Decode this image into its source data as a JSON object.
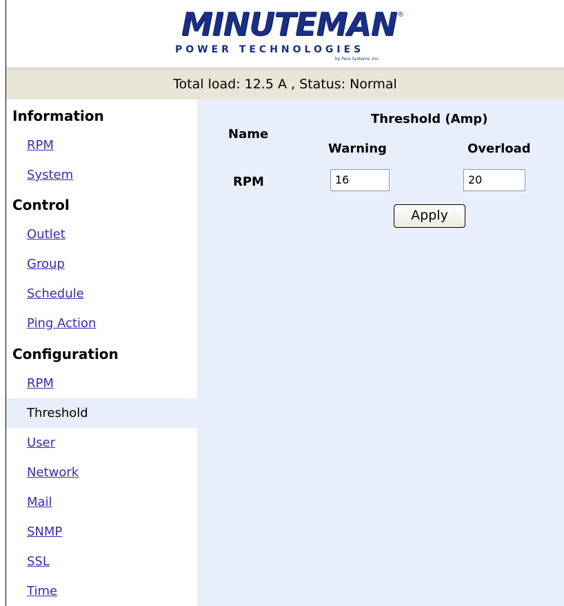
{
  "brand": {
    "logo_text": "MINUTEMAN",
    "subtitle": "POWER TECHNOLOGIES",
    "tagline": "by Para Systems, Inc.",
    "registered_mark": "®",
    "color": "#1a2e86"
  },
  "status_bar": {
    "text": "Total load: 12.5 A , Status: Normal"
  },
  "sidebar": {
    "sections": [
      {
        "title": "Information",
        "items": [
          "RPM",
          "System"
        ]
      },
      {
        "title": "Control",
        "items": [
          "Outlet",
          "Group",
          "Schedule",
          "Ping Action"
        ]
      },
      {
        "title": "Configuration",
        "items": [
          "RPM",
          "Threshold",
          "User",
          "Network",
          "Mail",
          "SNMP",
          "SSL",
          "Time"
        ]
      }
    ],
    "active_item": "Threshold"
  },
  "threshold_table": {
    "header_group": "Threshold (Amp)",
    "col_name": "Name",
    "col_warning": "Warning",
    "col_overload": "Overload",
    "rows": [
      {
        "name": "RPM",
        "warning": "16",
        "overload": "20"
      }
    ],
    "apply_label": "Apply"
  }
}
